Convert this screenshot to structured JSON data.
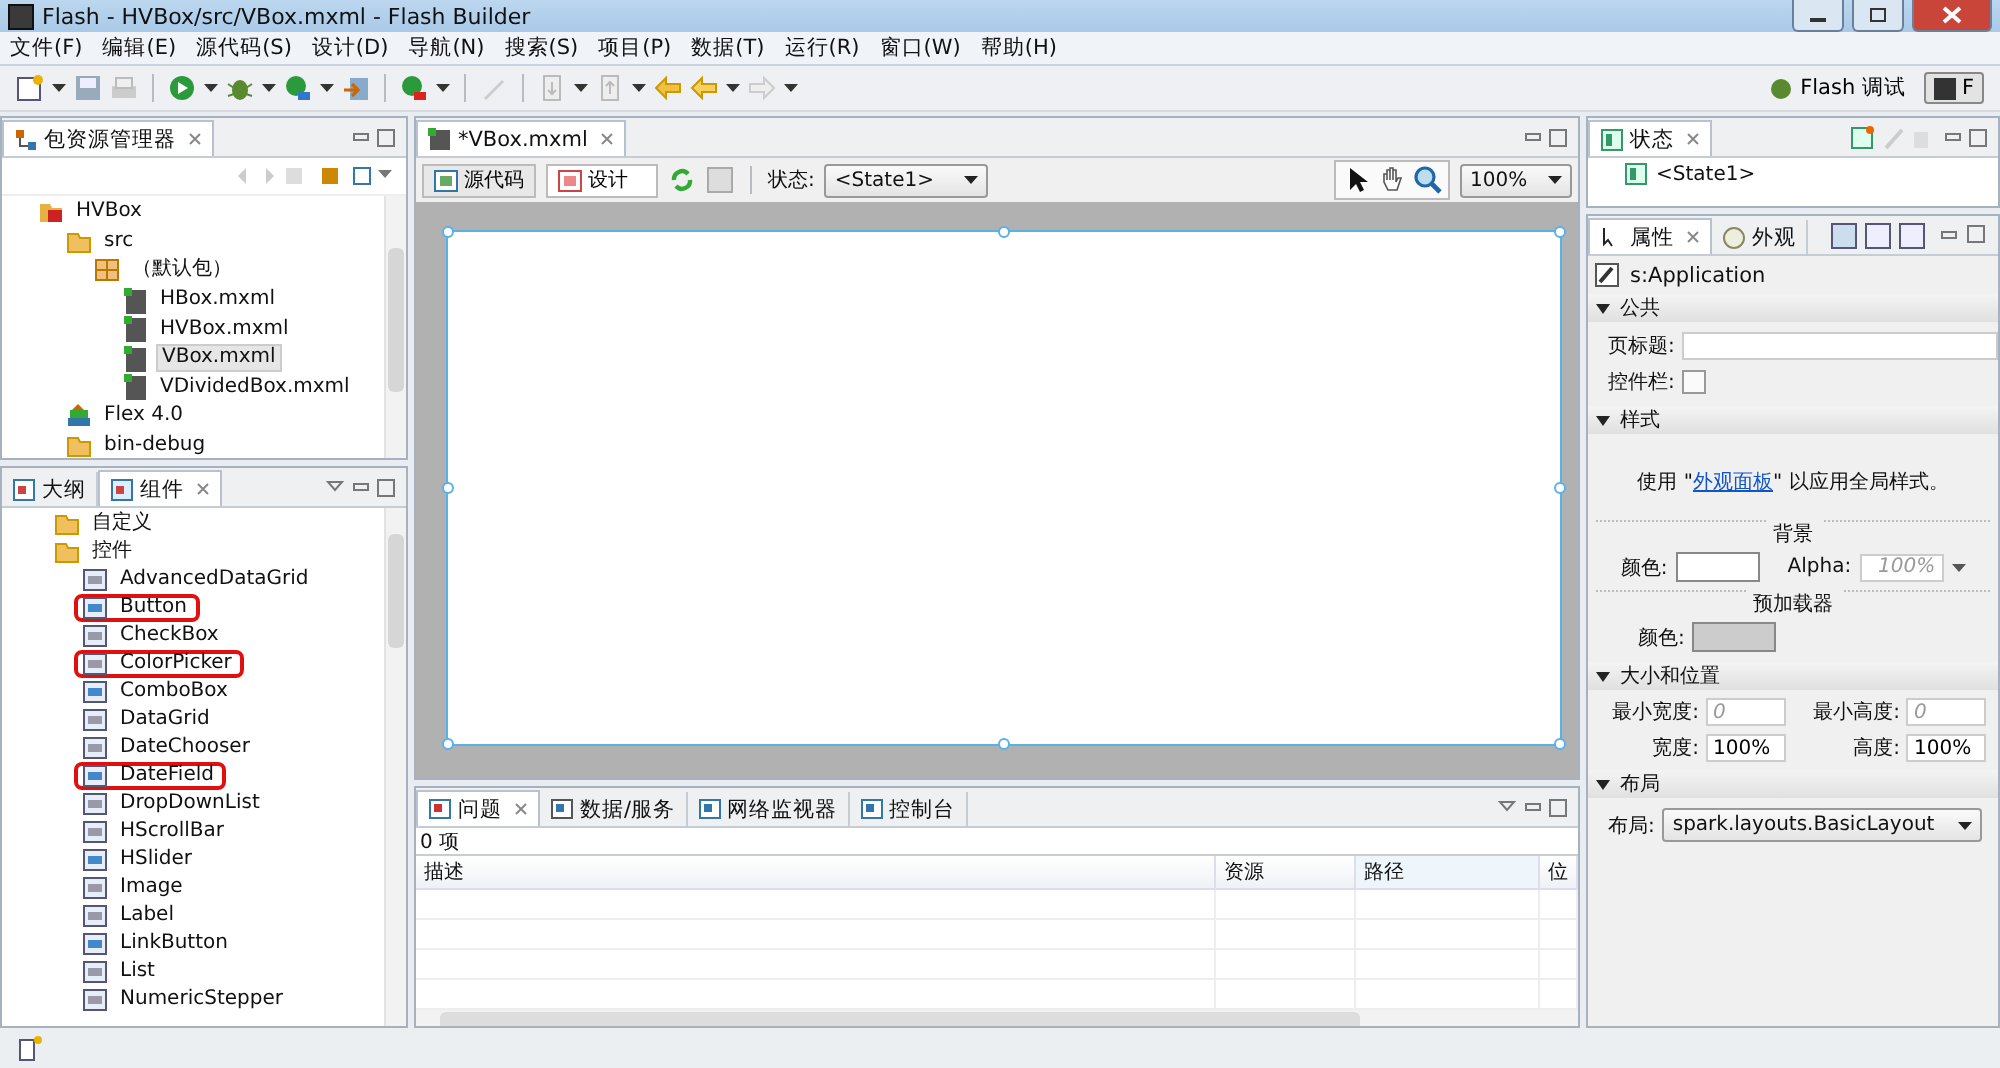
{
  "window": {
    "title": "Flash  -  HVBox/src/VBox.mxml  -  Flash Builder"
  },
  "menu": [
    "文件(F)",
    "编辑(E)",
    "源代码(S)",
    "设计(D)",
    "导航(N)",
    "搜索(S)",
    "项目(P)",
    "数据(T)",
    "运行(R)",
    "窗口(W)",
    "帮助(H)"
  ],
  "perspectives": [
    {
      "label": "Flash 调试",
      "selected": false
    },
    {
      "label": "F",
      "selected": true
    }
  ],
  "package_explorer": {
    "title": "包资源管理器",
    "tree": [
      {
        "label": "HVBox",
        "kind": "project",
        "selected": false,
        "children": [
          {
            "label": "src",
            "kind": "folder",
            "selected": false,
            "children": [
              {
                "label": "（默认包）",
                "kind": "package",
                "selected": false,
                "children": [
                  {
                    "label": "HBox.mxml",
                    "kind": "file",
                    "selected": false
                  },
                  {
                    "label": "HVBox.mxml",
                    "kind": "file",
                    "selected": false
                  },
                  {
                    "label": "VBox.mxml",
                    "kind": "file",
                    "selected": true
                  },
                  {
                    "label": "VDividedBox.mxml",
                    "kind": "file",
                    "selected": false
                  }
                ]
              }
            ]
          },
          {
            "label": "Flex 4.0",
            "kind": "library",
            "selected": false
          },
          {
            "label": "bin-debug",
            "kind": "folder",
            "selected": false
          }
        ]
      }
    ]
  },
  "components_panel": {
    "tabs": [
      {
        "label": "大纲",
        "selected": false
      },
      {
        "label": "组件",
        "selected": true
      }
    ],
    "tree": [
      {
        "label": "自定义",
        "kind": "folder",
        "highlighted": false
      },
      {
        "label": "控件",
        "kind": "folder",
        "highlighted": false,
        "children": [
          {
            "label": "AdvancedDataGrid",
            "kind": "component",
            "highlighted": false
          },
          {
            "label": "Button",
            "kind": "component",
            "highlighted": true
          },
          {
            "label": "CheckBox",
            "kind": "component",
            "highlighted": false
          },
          {
            "label": "ColorPicker",
            "kind": "component",
            "highlighted": true
          },
          {
            "label": "ComboBox",
            "kind": "component",
            "highlighted": false
          },
          {
            "label": "DataGrid",
            "kind": "component",
            "highlighted": false
          },
          {
            "label": "DateChooser",
            "kind": "component",
            "highlighted": false
          },
          {
            "label": "DateField",
            "kind": "component",
            "highlighted": true
          },
          {
            "label": "DropDownList",
            "kind": "component",
            "highlighted": false
          },
          {
            "label": "HScrollBar",
            "kind": "component",
            "highlighted": false
          },
          {
            "label": "HSlider",
            "kind": "component",
            "highlighted": false
          },
          {
            "label": "Image",
            "kind": "component",
            "highlighted": false
          },
          {
            "label": "Label",
            "kind": "component",
            "highlighted": false
          },
          {
            "label": "LinkButton",
            "kind": "component",
            "highlighted": false
          },
          {
            "label": "List",
            "kind": "component",
            "highlighted": false
          },
          {
            "label": "NumericStepper",
            "kind": "component",
            "highlighted": false
          }
        ]
      }
    ]
  },
  "editor": {
    "tab": "*VBox.mxml",
    "modes": [
      {
        "label": "源代码",
        "selected": false
      },
      {
        "label": "设计",
        "selected": true
      }
    ],
    "state_label": "状态:",
    "state_value": "<State1>",
    "zoom": "100%"
  },
  "bottom_panel": {
    "tabs": [
      {
        "label": "问题",
        "selected": true
      },
      {
        "label": "数据/服务",
        "selected": false
      },
      {
        "label": "网络监视器",
        "selected": false
      },
      {
        "label": "控制台",
        "selected": false
      }
    ],
    "count": "0 项",
    "columns": [
      "描述",
      "资源",
      "路径",
      "位"
    ]
  },
  "states_panel": {
    "title": "状态",
    "items": [
      "<State1>"
    ]
  },
  "properties_panel": {
    "tabs": [
      {
        "label": "属性",
        "selected": true
      },
      {
        "label": "外观",
        "selected": false
      }
    ],
    "component": "s:Application",
    "sections": [
      {
        "title": "公共",
        "kind": "common",
        "title_label": "页标题:",
        "controlbar_label": "控件栏:",
        "controlbar_checked": false
      },
      {
        "title": "样式",
        "kind": "style",
        "hint_before": "使用 \"",
        "hint_link": "外观面板",
        "hint_after": "\" 以应用全局样式。",
        "background": {
          "title": "背景",
          "color_label": "颜色:",
          "color": "#ffffff",
          "alpha_label": "Alpha:",
          "alpha_placeholder": "100%"
        },
        "preloader": {
          "title": "预加载器",
          "color_label": "颜色:",
          "color": "#cccccc"
        }
      },
      {
        "title": "大小和位置",
        "kind": "size",
        "fields": [
          {
            "label": "最小宽度:",
            "placeholder": "0"
          },
          {
            "label": "最小高度:",
            "placeholder": "0"
          },
          {
            "label": "宽度:",
            "value": "100%"
          },
          {
            "label": "高度:",
            "value": "100%"
          }
        ]
      },
      {
        "title": "布局",
        "kind": "layout",
        "label": "布局:",
        "value": "spark.layouts.BasicLayout"
      }
    ]
  }
}
